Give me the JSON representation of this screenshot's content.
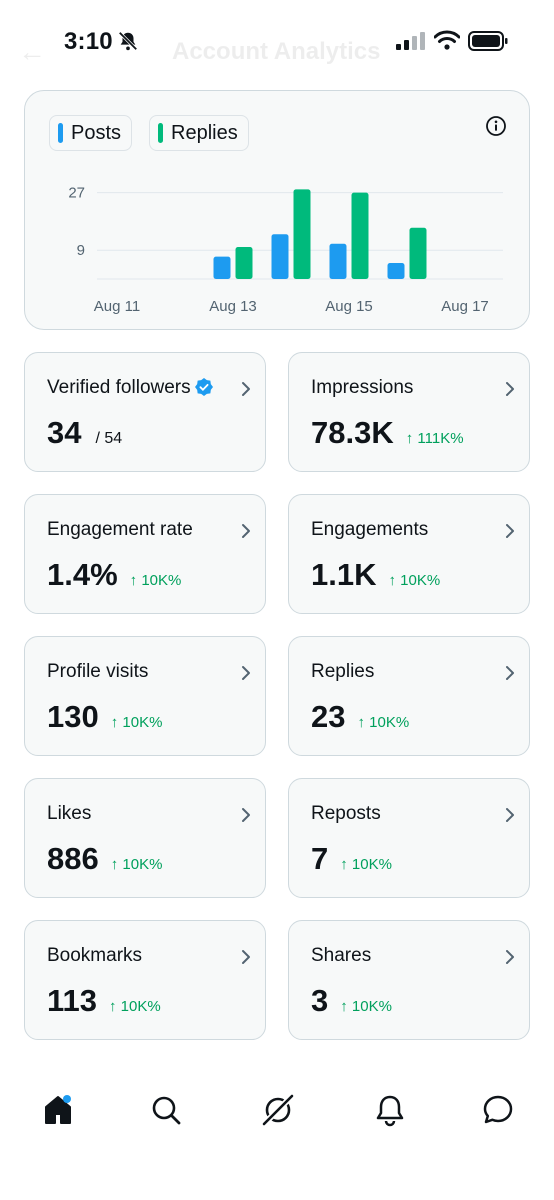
{
  "status_bar": {
    "time": "3:10",
    "icons": [
      "bell-off-icon",
      "signal-icon",
      "wifi-icon",
      "battery-icon"
    ]
  },
  "header": {
    "title": "Account Analytics",
    "back_icon": "back-arrow-icon"
  },
  "colors": {
    "posts": "#1d9bf0",
    "replies": "#00ba7c",
    "positive_change": "#00a05c",
    "card_border": "#cfd9de",
    "card_bg": "#f7f9f9"
  },
  "legend": {
    "posts": "Posts",
    "replies": "Replies"
  },
  "chart_data": {
    "type": "bar",
    "categories": [
      "Aug 11",
      "Aug 12",
      "Aug 13",
      "Aug 14",
      "Aug 15",
      "Aug 16",
      "Aug 17"
    ],
    "x_tick_labels": [
      "Aug 11",
      "Aug 13",
      "Aug 15",
      "Aug 17"
    ],
    "y_tick_labels": [
      "27",
      "9"
    ],
    "y_ticks": [
      27,
      9
    ],
    "ylim": [
      0,
      30
    ],
    "series": [
      {
        "name": "Posts",
        "values": [
          0,
          0,
          7,
          14,
          11,
          5,
          0
        ]
      },
      {
        "name": "Replies",
        "values": [
          0,
          0,
          10,
          28,
          27,
          16,
          0
        ]
      }
    ],
    "grid": true,
    "legend_position": "top-left"
  },
  "metrics": [
    {
      "label": "Verified followers",
      "value": "34",
      "total": "/ 54",
      "change": "",
      "verified": true
    },
    {
      "label": "Impressions",
      "value": "78.3K",
      "total": "",
      "change": "↑ 111K%"
    },
    {
      "label": "Engagement rate",
      "value": "1.4%",
      "total": "",
      "change": "↑ 10K%"
    },
    {
      "label": "Engagements",
      "value": "1.1K",
      "total": "",
      "change": "↑ 10K%"
    },
    {
      "label": "Profile visits",
      "value": "130",
      "total": "",
      "change": "↑ 10K%"
    },
    {
      "label": "Replies",
      "value": "23",
      "total": "",
      "change": "↑ 10K%"
    },
    {
      "label": "Likes",
      "value": "886",
      "total": "",
      "change": "↑ 10K%"
    },
    {
      "label": "Reposts",
      "value": "7",
      "total": "",
      "change": "↑ 10K%"
    },
    {
      "label": "Bookmarks",
      "value": "113",
      "total": "",
      "change": "↑ 10K%"
    },
    {
      "label": "Shares",
      "value": "3",
      "total": "",
      "change": "↑ 10K%"
    }
  ],
  "bottom_nav": [
    "home-icon",
    "search-icon",
    "grok-icon",
    "notifications-icon",
    "messages-icon"
  ]
}
